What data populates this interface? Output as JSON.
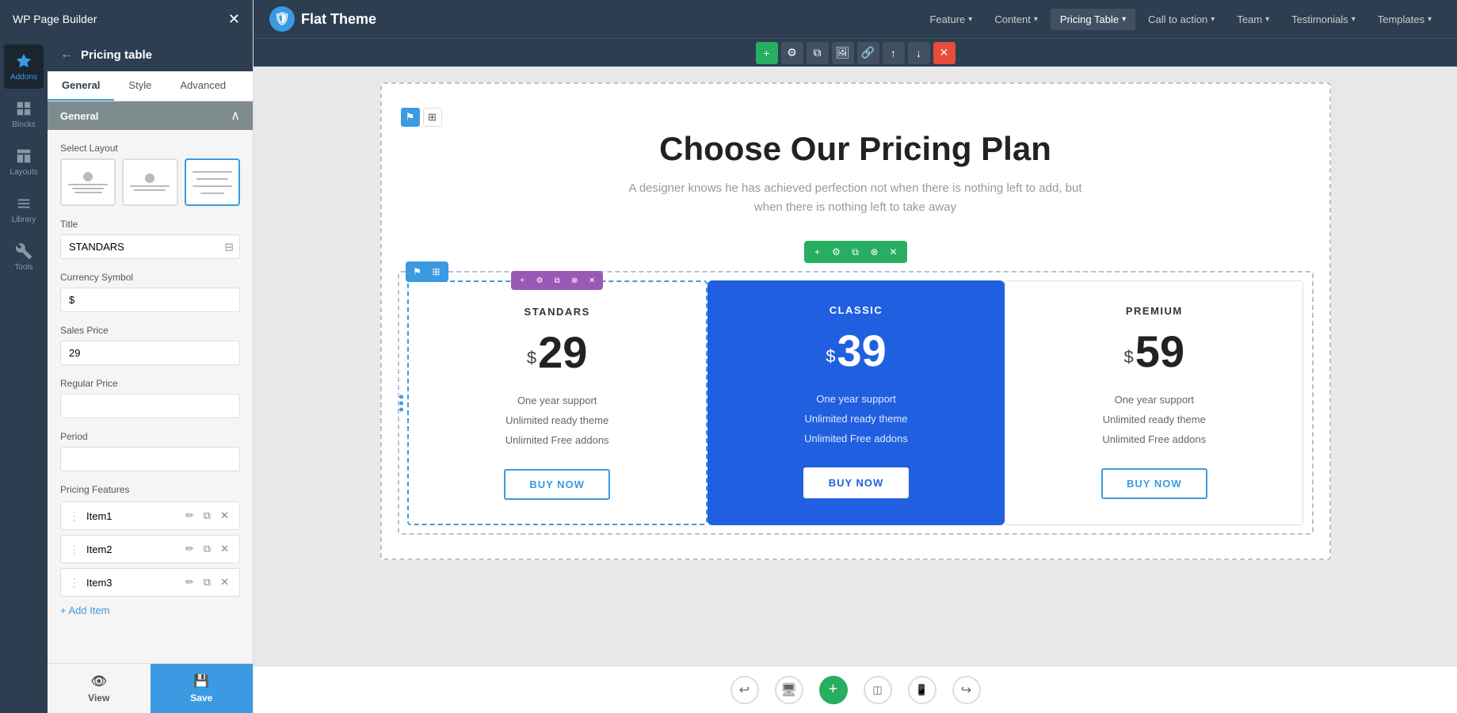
{
  "app": {
    "title": "WP Page Builder"
  },
  "topnav": {
    "logo_text": "Flat Theme",
    "menu_items": [
      {
        "label": "Feature",
        "has_dropdown": true
      },
      {
        "label": "Content",
        "has_dropdown": true
      },
      {
        "label": "Pricing Table",
        "has_dropdown": true,
        "active": true
      },
      {
        "label": "Call to action",
        "has_dropdown": true
      },
      {
        "label": "Team",
        "has_dropdown": true
      },
      {
        "label": "Testimonials",
        "has_dropdown": true
      },
      {
        "label": "Templates",
        "has_dropdown": true
      }
    ]
  },
  "sidebar": {
    "icons": [
      {
        "id": "addons",
        "label": "Addons",
        "active": true
      },
      {
        "id": "blocks",
        "label": "Blocks"
      },
      {
        "id": "layouts",
        "label": "Layouts"
      },
      {
        "id": "library",
        "label": "Library"
      },
      {
        "id": "tools",
        "label": "Tools"
      }
    ],
    "panel_title": "Pricing table",
    "tabs": [
      {
        "label": "General",
        "active": true
      },
      {
        "label": "Style"
      },
      {
        "label": "Advanced"
      }
    ],
    "section_label": "General",
    "layout_select": {
      "label": "Select Layout",
      "options": [
        {
          "id": "layout1"
        },
        {
          "id": "layout2"
        },
        {
          "id": "layout3",
          "selected": true
        }
      ]
    },
    "title_label": "Title",
    "title_value": "STANDARS",
    "currency_symbol_label": "Currency Symbol",
    "currency_symbol_value": "$",
    "sales_price_label": "Sales Price",
    "sales_price_value": "29",
    "regular_price_label": "Regular Price",
    "regular_price_value": "",
    "period_label": "Period",
    "period_value": "",
    "pricing_features_label": "Pricing Features",
    "features": [
      {
        "label": "Item1"
      },
      {
        "label": "Item2"
      },
      {
        "label": "Item3"
      }
    ],
    "add_item_label": "+ Add Item",
    "view_label": "View",
    "save_label": "Save"
  },
  "canvas": {
    "section_title": "Choose Our Pricing Plan",
    "section_subtitle": "A designer knows he has achieved perfection not when there is nothing left to add, but when there is nothing left to take away",
    "cards": [
      {
        "name": "STANDARS",
        "currency": "$",
        "price": "29",
        "features": [
          "One year support",
          "Unlimited ready theme",
          "Unlimited Free addons"
        ],
        "btn_label": "BUY NOW",
        "featured": false,
        "selected": true
      },
      {
        "name": "CLASSIC",
        "currency": "$",
        "price": "39",
        "features": [
          "One year support",
          "Unlimited ready theme",
          "Unlimited Free addons"
        ],
        "btn_label": "BUY NOW",
        "featured": true,
        "selected": false
      },
      {
        "name": "PREMIUM",
        "currency": "$",
        "price": "59",
        "features": [
          "One year support",
          "Unlimited ready theme",
          "Unlimited Free addons"
        ],
        "btn_label": "BUY NOW",
        "featured": false,
        "selected": false
      }
    ]
  },
  "toolbar": {
    "add_icon": "+",
    "settings_icon": "⚙",
    "copy_icon": "⧉",
    "link_icon": "🔗",
    "up_icon": "↑",
    "down_icon": "↓",
    "delete_icon": "✕"
  },
  "bottom": {
    "add_icon": "+",
    "undo_icon": "↩",
    "desktop_icon": "🖥",
    "tablet_icon": "📱",
    "mobile_icon": "📱",
    "redo_icon": "↪"
  }
}
